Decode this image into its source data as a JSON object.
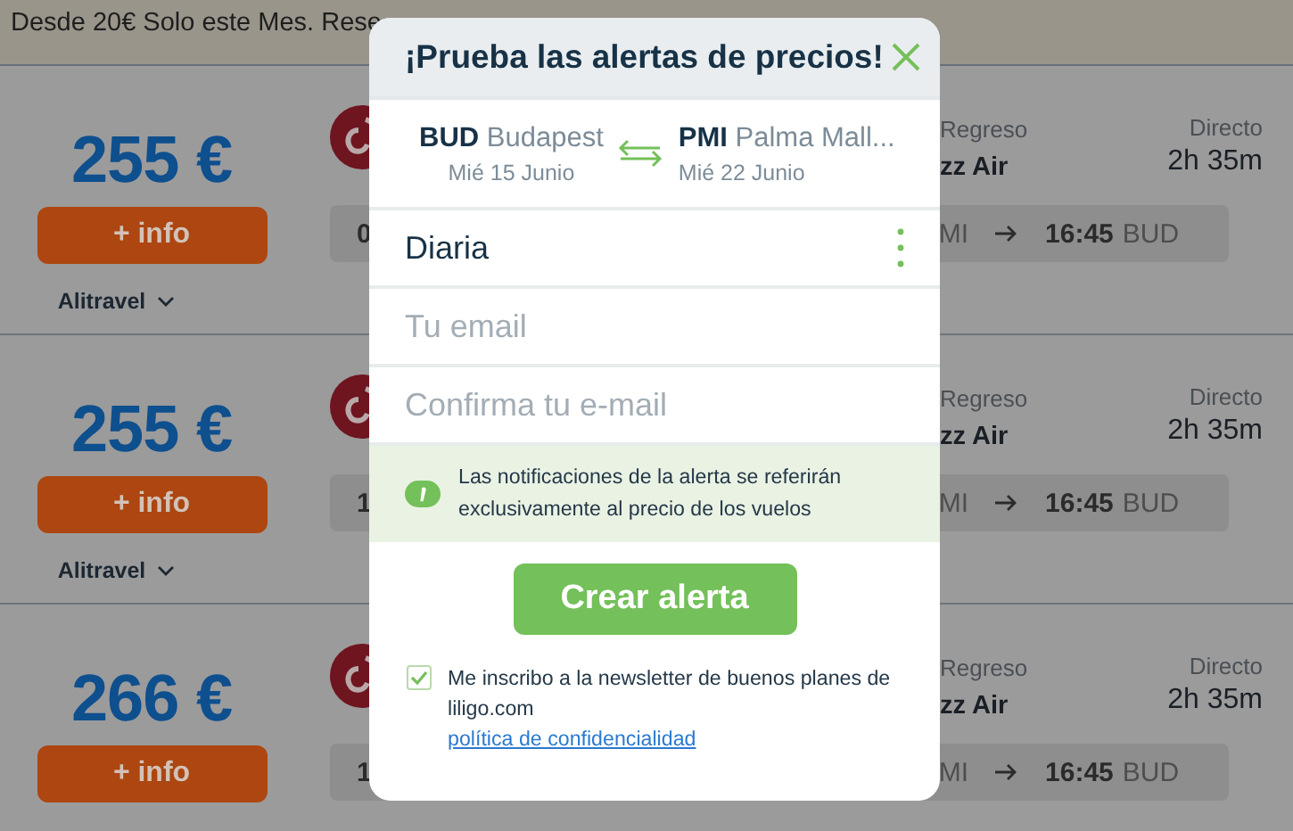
{
  "banner": {
    "text": "Desde 20€ Solo este Mes. Rese"
  },
  "results": [
    {
      "price": "255 €",
      "info_button": "+ info",
      "provider": "Alitravel",
      "box_start": "0",
      "return_label": "Regreso",
      "airline": "zz Air",
      "stops": "Directo",
      "duration": "2h 35m",
      "from": "MI",
      "arrival_time": "16:45",
      "to": "BUD"
    },
    {
      "price": "255 €",
      "info_button": "+ info",
      "provider": "Alitravel",
      "box_start": "1",
      "return_label": "Regreso",
      "airline": "zz Air",
      "stops": "Directo",
      "duration": "2h 35m",
      "from": "MI",
      "arrival_time": "16:45",
      "to": "BUD"
    },
    {
      "price": "266 €",
      "info_button": "+ info",
      "box_start": "1",
      "return_label": "Regreso",
      "airline": "zz Air",
      "stops": "Directo",
      "duration": "2h 35m",
      "from": "MI",
      "arrival_time": "16:45",
      "to": "BUD"
    }
  ],
  "modal": {
    "title": "¡Prueba las alertas de precios!",
    "route": {
      "origin": {
        "code": "BUD",
        "city": "Budapest",
        "date": "Mié 15 Junio"
      },
      "destination": {
        "code": "PMI",
        "city": "Palma Mall...",
        "date": "Mié 22 Junio"
      }
    },
    "frequency": {
      "value": "Diaria"
    },
    "email": {
      "placeholder": "Tu email"
    },
    "confirm_email": {
      "placeholder": "Confirma tu e-mail"
    },
    "notice": "Las notificaciones de la alerta se referirán exclusivamente al precio de los vuelos",
    "submit": "Crear alerta",
    "newsletter": {
      "checked": true,
      "text": "Me inscribo a la newsletter de buenos planes de liligo.com",
      "link": "política de confidencialidad"
    }
  }
}
